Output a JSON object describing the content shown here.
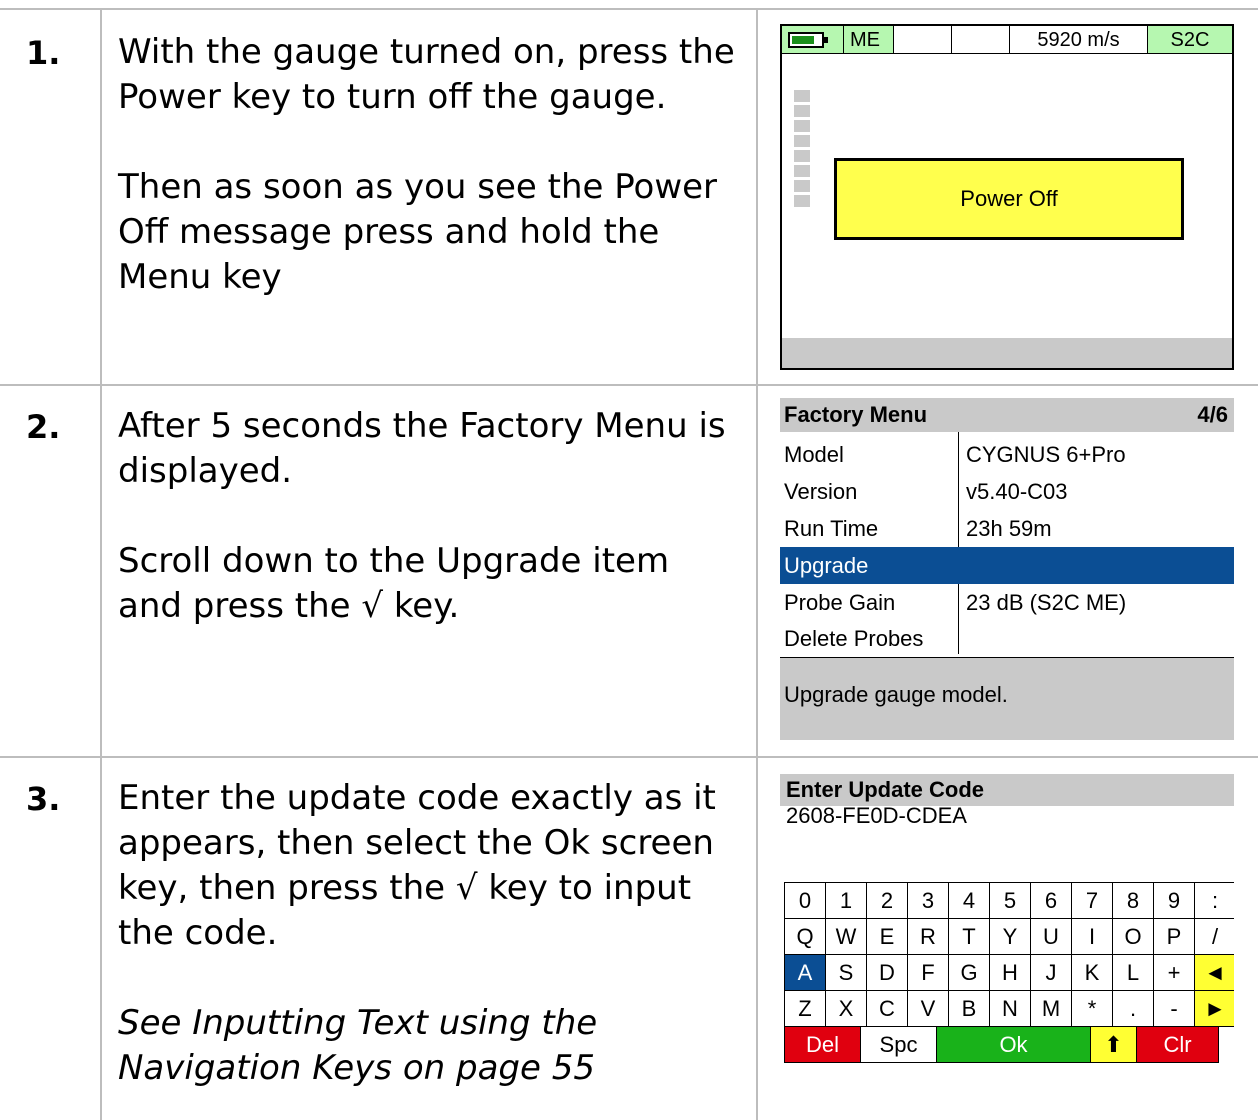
{
  "steps": [
    {
      "number": "1.",
      "paragraphs": [
        "With the gauge turned on, press the Power key to turn off the gauge.",
        "Then as soon as you see the Power Off message press and hold the Menu key"
      ]
    },
    {
      "number": "2.",
      "paragraphs": [
        "After 5 seconds the Factory Menu is displayed.",
        "Scroll down to the Upgrade item and press the √ key."
      ]
    },
    {
      "number": "3.",
      "paragraphs": [
        "Enter the update code exactly as it appears, then select the Ok screen key, then press the √ key to input the code.",
        "See Inputting Text using the Navigation Keys on page 55"
      ]
    }
  ],
  "screen1": {
    "mode": "ME",
    "velocity": "5920 m/s",
    "probe": "S2C",
    "message": "Power Off",
    "colors": {
      "status_green": "#b6f7b0",
      "message_bg": "#ffff4d"
    }
  },
  "factory_menu": {
    "title": "Factory Menu",
    "page": "4/6",
    "rows": [
      {
        "key": "Model",
        "value": "CYGNUS 6+Pro"
      },
      {
        "key": "Version",
        "value": "v5.40-C03"
      },
      {
        "key": "Run Time",
        "value": "23h 59m"
      },
      {
        "key": "Upgrade",
        "value": ""
      },
      {
        "key": "Probe Gain",
        "value": "23 dB (S2C ME)"
      },
      {
        "key": "Delete Probes",
        "value": ""
      }
    ],
    "selected_row": "Upgrade",
    "help_text": "Upgrade gauge model.",
    "colors": {
      "selected_bg": "#0b4e94"
    }
  },
  "update_code": {
    "title": "Enter Update Code",
    "code": "2608-FE0D-CDEA",
    "keyboard": {
      "row1": [
        "0",
        "1",
        "2",
        "3",
        "4",
        "5",
        "6",
        "7",
        "8",
        "9",
        ":"
      ],
      "row2": [
        "Q",
        "W",
        "E",
        "R",
        "T",
        "Y",
        "U",
        "I",
        "O",
        "P",
        "/"
      ],
      "row3": [
        "A",
        "S",
        "D",
        "F",
        "G",
        "H",
        "J",
        "K",
        "L",
        "+",
        "◄"
      ],
      "row4": [
        "Z",
        "X",
        "C",
        "V",
        "B",
        "N",
        "M",
        "*",
        ".",
        "-",
        "►"
      ],
      "row5": [
        "Del",
        "Spc",
        "Ok",
        "⬆",
        "Clr"
      ]
    },
    "selected_key": "A",
    "colors": {
      "del": "#e0000f",
      "ok": "#19b21a",
      "arrows": "#ffff33"
    }
  }
}
